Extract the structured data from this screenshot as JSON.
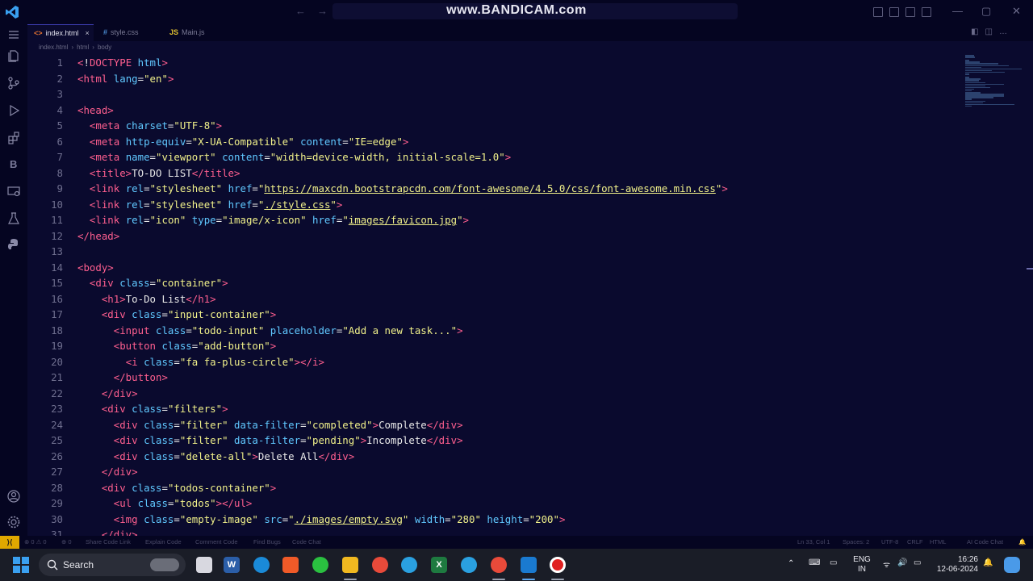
{
  "window": {
    "watermark": "www.BANDICAM.com",
    "minimize": "—",
    "restore": "▢",
    "close": "✕"
  },
  "tabs": [
    {
      "icon": "<>",
      "label": "index.html",
      "close": "×"
    },
    {
      "icon": "#",
      "label": "style.css"
    },
    {
      "icon": "JS",
      "label": "Main.js"
    }
  ],
  "breadcrumb": [
    "index.html",
    "html",
    "body"
  ],
  "editor": {
    "lines": [
      {
        "n": "1",
        "html": "<span class=\"t\">&lt;</span><span class=\"bang\">!</span><span class=\"t\">DOCTYPE</span> <span class=\"a\">html</span><span class=\"t\">&gt;</span>"
      },
      {
        "n": "2",
        "html": "<span class=\"t\">&lt;html</span> <span class=\"a\">lang</span>=<span class=\"s\">\"en\"</span><span class=\"t\">&gt;</span>"
      },
      {
        "n": "3",
        "html": ""
      },
      {
        "n": "4",
        "html": "<span class=\"t\">&lt;head&gt;</span>"
      },
      {
        "n": "5",
        "html": "  <span class=\"t\">&lt;meta</span> <span class=\"a\">charset</span>=<span class=\"s\">\"UTF-8\"</span><span class=\"t\">&gt;</span>"
      },
      {
        "n": "6",
        "html": "  <span class=\"t\">&lt;meta</span> <span class=\"a\">http-equiv</span>=<span class=\"s\">\"X-UA-Compatible\"</span> <span class=\"a\">content</span>=<span class=\"s\">\"IE=edge\"</span><span class=\"t\">&gt;</span>"
      },
      {
        "n": "7",
        "html": "  <span class=\"t\">&lt;meta</span> <span class=\"a\">name</span>=<span class=\"s\">\"viewport\"</span> <span class=\"a\">content</span>=<span class=\"s\">\"width=device-width, initial-scale=1.0\"</span><span class=\"t\">&gt;</span>"
      },
      {
        "n": "8",
        "html": "  <span class=\"t\">&lt;title&gt;</span>TO-DO LIST<span class=\"t\">&lt;/title&gt;</span>"
      },
      {
        "n": "9",
        "html": "  <span class=\"t\">&lt;link</span> <span class=\"a\">rel</span>=<span class=\"s\">\"stylesheet\"</span> <span class=\"a\">href</span>=<span class=\"s\">\"<span class=\"u\">https://maxcdn.bootstrapcdn.com/font-awesome/4.5.0/css/font-awesome.min.css</span>\"</span><span class=\"t\">&gt;</span>"
      },
      {
        "n": "10",
        "html": "  <span class=\"t\">&lt;link</span> <span class=\"a\">rel</span>=<span class=\"s\">\"stylesheet\"</span> <span class=\"a\">href</span>=<span class=\"s\">\"<span class=\"u\">./style.css</span>\"</span><span class=\"t\">&gt;</span>"
      },
      {
        "n": "11",
        "html": "  <span class=\"t\">&lt;link</span> <span class=\"a\">rel</span>=<span class=\"s\">\"icon\"</span> <span class=\"a\">type</span>=<span class=\"s\">\"image/x-icon\"</span> <span class=\"a\">href</span>=<span class=\"s\">\"<span class=\"u\">images/favicon.jpg</span>\"</span><span class=\"t\">&gt;</span>"
      },
      {
        "n": "12",
        "html": "<span class=\"t\">&lt;/head&gt;</span>"
      },
      {
        "n": "13",
        "html": ""
      },
      {
        "n": "14",
        "html": "<span class=\"t\">&lt;body&gt;</span>"
      },
      {
        "n": "15",
        "html": "  <span class=\"t\">&lt;div</span> <span class=\"a\">class</span>=<span class=\"s\">\"container\"</span><span class=\"t\">&gt;</span>"
      },
      {
        "n": "16",
        "html": "    <span class=\"t\">&lt;h1&gt;</span>To-Do List<span class=\"t\">&lt;/h1&gt;</span>"
      },
      {
        "n": "17",
        "html": "    <span class=\"t\">&lt;div</span> <span class=\"a\">class</span>=<span class=\"s\">\"input-container\"</span><span class=\"t\">&gt;</span>"
      },
      {
        "n": "18",
        "html": "      <span class=\"t\">&lt;input</span> <span class=\"a\">class</span>=<span class=\"s\">\"todo-input\"</span> <span class=\"a\">placeholder</span>=<span class=\"s\">\"Add a new task...\"</span><span class=\"t\">&gt;</span>"
      },
      {
        "n": "19",
        "html": "      <span class=\"t\">&lt;button</span> <span class=\"a\">class</span>=<span class=\"s\">\"add-button\"</span><span class=\"t\">&gt;</span>"
      },
      {
        "n": "20",
        "html": "        <span class=\"t\">&lt;i</span> <span class=\"a\">class</span>=<span class=\"s\">\"fa fa-plus-circle\"</span><span class=\"t\">&gt;&lt;/i&gt;</span>"
      },
      {
        "n": "21",
        "html": "      <span class=\"t\">&lt;/button&gt;</span>"
      },
      {
        "n": "22",
        "html": "    <span class=\"t\">&lt;/div&gt;</span>"
      },
      {
        "n": "23",
        "html": "    <span class=\"t\">&lt;div</span> <span class=\"a\">class</span>=<span class=\"s\">\"filters\"</span><span class=\"t\">&gt;</span>"
      },
      {
        "n": "24",
        "html": "      <span class=\"t\">&lt;div</span> <span class=\"a\">class</span>=<span class=\"s\">\"filter\"</span> <span class=\"a\">data-filter</span>=<span class=\"s\">\"completed\"</span><span class=\"t\">&gt;</span>Complete<span class=\"t\">&lt;/div&gt;</span>"
      },
      {
        "n": "25",
        "html": "      <span class=\"t\">&lt;div</span> <span class=\"a\">class</span>=<span class=\"s\">\"filter\"</span> <span class=\"a\">data-filter</span>=<span class=\"s\">\"pending\"</span><span class=\"t\">&gt;</span>Incomplete<span class=\"t\">&lt;/div&gt;</span>"
      },
      {
        "n": "26",
        "html": "      <span class=\"t\">&lt;div</span> <span class=\"a\">class</span>=<span class=\"s\">\"delete-all\"</span><span class=\"t\">&gt;</span>Delete All<span class=\"t\">&lt;/div&gt;</span>"
      },
      {
        "n": "27",
        "html": "    <span class=\"t\">&lt;/div&gt;</span>"
      },
      {
        "n": "28",
        "html": "    <span class=\"t\">&lt;div</span> <span class=\"a\">class</span>=<span class=\"s\">\"todos-container\"</span><span class=\"t\">&gt;</span>"
      },
      {
        "n": "29",
        "html": "      <span class=\"t\">&lt;ul</span> <span class=\"a\">class</span>=<span class=\"s\">\"todos\"</span><span class=\"t\">&gt;&lt;/ul&gt;</span>"
      },
      {
        "n": "30",
        "html": "      <span class=\"t\">&lt;img</span> <span class=\"a\">class</span>=<span class=\"s\">\"empty-image\"</span> <span class=\"a\">src</span>=<span class=\"s\">\"<span class=\"u\">./images/empty.svg</span>\"</span> <span class=\"a\">width</span>=<span class=\"s\">\"280\"</span> <span class=\"a\">height</span>=<span class=\"s\">\"200\"</span><span class=\"t\">&gt;</span>"
      },
      {
        "n": "31",
        "html": "    <span class=\"t\">&lt;/div&gt;</span>"
      }
    ]
  },
  "statusbar": {
    "remote": "⟩⟨",
    "problems": "⊗ 0 ⚠ 0",
    "ports": "⊕ 0",
    "left_items": [
      "Share Code Link",
      "Explain Code",
      "Comment Code",
      "Find Bugs",
      "Code Chat"
    ],
    "cursor": "Ln 33, Col 1",
    "spaces": "Spaces: 2",
    "encoding": "UTF-8",
    "eol": "CRLF",
    "language": "HTML",
    "ai": "AI Code Chat"
  },
  "taskbar": {
    "search_label": "Search",
    "lang_top": "ENG",
    "lang_bottom": "IN",
    "time": "16:26",
    "date": "12-06-2024"
  },
  "colors": {
    "editor_bg": "#0a0a2e",
    "tag": "#ff5f8f",
    "attribute": "#60c8ff",
    "string": "#f0f08a",
    "remote_indicator": "#e0a800"
  }
}
